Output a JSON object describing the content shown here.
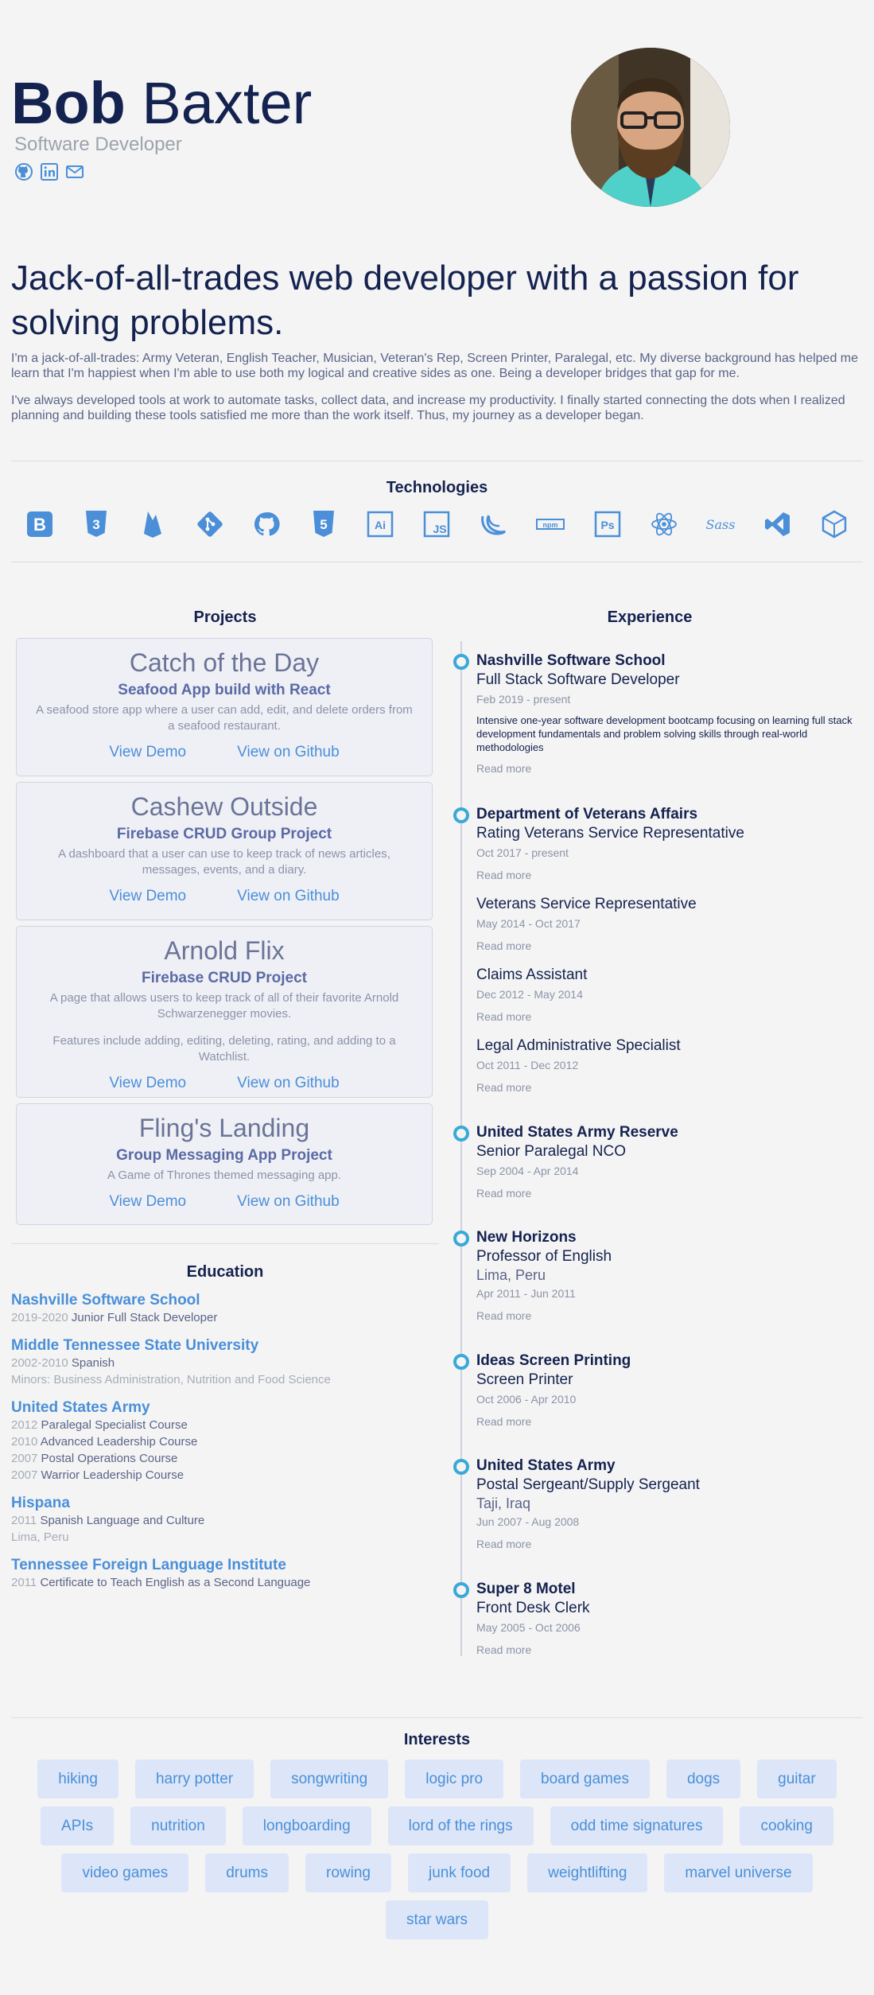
{
  "header": {
    "first_name": "Bob",
    "last_name": "Baxter",
    "role": "Software Developer",
    "socials": [
      {
        "icon": "github-icon"
      },
      {
        "icon": "linkedin-icon"
      },
      {
        "icon": "email-icon"
      }
    ]
  },
  "intro": {
    "headline": "Jack-of-all-trades web developer with a passion for solving problems.",
    "p1": "I'm a jack-of-all-trades: Army Veteran, English Teacher, Musician, Veteran's Rep, Screen Printer, Paralegal, etc. My diverse background has helped me learn that I'm happiest when I'm able to use both my logical and creative sides as one. Being a developer bridges that gap for me.",
    "p2": "I've always developed tools at work to automate tasks, collect data, and increase my productivity. I finally started connecting the dots when I realized planning and building these tools satisfied me more than the work itself. Thus, my journey as a developer began."
  },
  "technologies": {
    "title": "Technologies",
    "icons": [
      "bootstrap-icon",
      "css3-icon",
      "firebase-icon",
      "git-icon",
      "github-icon",
      "html5-icon",
      "illustrator-icon",
      "javascript-icon",
      "jquery-icon",
      "npm-icon",
      "photoshop-icon",
      "react-icon",
      "sass-icon",
      "vscode-icon",
      "codesandbox-icon"
    ]
  },
  "projects": {
    "title": "Projects",
    "demo_label": "View Demo",
    "github_label": "View on Github",
    "items": [
      {
        "title": "Catch of the Day",
        "subtitle": "Seafood App build with React",
        "desc": "A seafood store app where a user can add, edit, and delete orders from a seafood restaurant.",
        "desc2": ""
      },
      {
        "title": "Cashew Outside",
        "subtitle": "Firebase CRUD Group Project",
        "desc": "A dashboard that a user can use to keep track of news articles, messages, events, and a diary.",
        "desc2": ""
      },
      {
        "title": "Arnold Flix",
        "subtitle": "Firebase CRUD Project",
        "desc": "A page that allows users to keep track of all of their favorite Arnold Schwarzenegger movies.",
        "desc2": "Features include adding, editing, deleting, rating, and adding to a Watchlist."
      },
      {
        "title": "Fling's Landing",
        "subtitle": "Group Messaging App Project",
        "desc": "A Game of Thrones themed messaging app.",
        "desc2": ""
      }
    ]
  },
  "education": {
    "title": "Education",
    "schools": [
      {
        "name": "Nashville Software School",
        "lines": [
          {
            "year": "2019-2020",
            "text": "Junior Full Stack Developer"
          }
        ]
      },
      {
        "name": "Middle Tennessee State University",
        "lines": [
          {
            "year": "2002-2010",
            "text": "Spanish"
          },
          {
            "year": "",
            "text": "Minors: Business Administration, Nutrition and Food Science",
            "muted": true
          }
        ]
      },
      {
        "name": "United States Army",
        "lines": [
          {
            "year": "2012",
            "text": "Paralegal Specialist Course"
          },
          {
            "year": "2010",
            "text": "Advanced Leadership Course"
          },
          {
            "year": "2007",
            "text": "Postal Operations Course"
          },
          {
            "year": "2007",
            "text": "Warrior Leadership Course"
          }
        ]
      },
      {
        "name": "Hispana",
        "lines": [
          {
            "year": "2011",
            "text": "Spanish Language and Culture"
          },
          {
            "year": "",
            "text": "Lima, Peru",
            "muted": true
          }
        ]
      },
      {
        "name": "Tennessee Foreign Language Institute",
        "lines": [
          {
            "year": "2011",
            "text": "Certificate to Teach English as a Second Language"
          }
        ]
      }
    ]
  },
  "experience": {
    "title": "Experience",
    "read_more": "Read more",
    "entries": [
      {
        "org": "Nashville Software School",
        "role": "Full Stack Software Developer",
        "loc": "",
        "date": "Feb 2019 - present",
        "desc": "Intensive one-year software development bootcamp focusing on learning full stack development fundamentals and problem solving skills through real-world methodologies"
      },
      {
        "org": "Department of Veterans Affairs",
        "role": "Rating Veterans Service Representative",
        "loc": "",
        "date": "Oct 2017 - present",
        "desc": ""
      },
      {
        "org": "",
        "role": "Veterans Service Representative",
        "loc": "",
        "date": "May 2014 - Oct 2017",
        "desc": ""
      },
      {
        "org": "",
        "role": "Claims Assistant",
        "loc": "",
        "date": "Dec 2012 - May 2014",
        "desc": ""
      },
      {
        "org": "",
        "role": "Legal Administrative Specialist",
        "loc": "",
        "date": "Oct 2011 - Dec 2012",
        "desc": ""
      },
      {
        "org": "United States Army Reserve",
        "role": "Senior Paralegal NCO",
        "loc": "",
        "date": "Sep 2004 - Apr 2014",
        "desc": ""
      },
      {
        "org": "New Horizons",
        "role": "Professor of English",
        "loc": "Lima, Peru",
        "date": "Apr 2011 - Jun 2011",
        "desc": ""
      },
      {
        "org": "Ideas Screen Printing",
        "role": "Screen Printer",
        "loc": "",
        "date": "Oct 2006 - Apr 2010",
        "desc": ""
      },
      {
        "org": "United States Army",
        "role": "Postal Sergeant/Supply Sergeant",
        "loc": "Taji, Iraq",
        "date": "Jun 2007 - Aug 2008",
        "desc": ""
      },
      {
        "org": "Super 8 Motel",
        "role": "Front Desk Clerk",
        "loc": "",
        "date": "May 2005 - Oct 2006",
        "desc": ""
      }
    ]
  },
  "interests": {
    "title": "Interests",
    "items": [
      "hiking",
      "harry potter",
      "songwriting",
      "logic pro",
      "board games",
      "dogs",
      "guitar",
      "APIs",
      "nutrition",
      "longboarding",
      "lord of the rings",
      "odd time signatures",
      "cooking",
      "video games",
      "drums",
      "rowing",
      "junk food",
      "weightlifting",
      "marvel universe",
      "star wars"
    ]
  },
  "colors": {
    "navy": "#14224f",
    "link": "#4a8fd8",
    "timeline_dot": "#3aa9d8",
    "chip_bg": "#dce6f8",
    "card_bg": "#eff0f6"
  }
}
